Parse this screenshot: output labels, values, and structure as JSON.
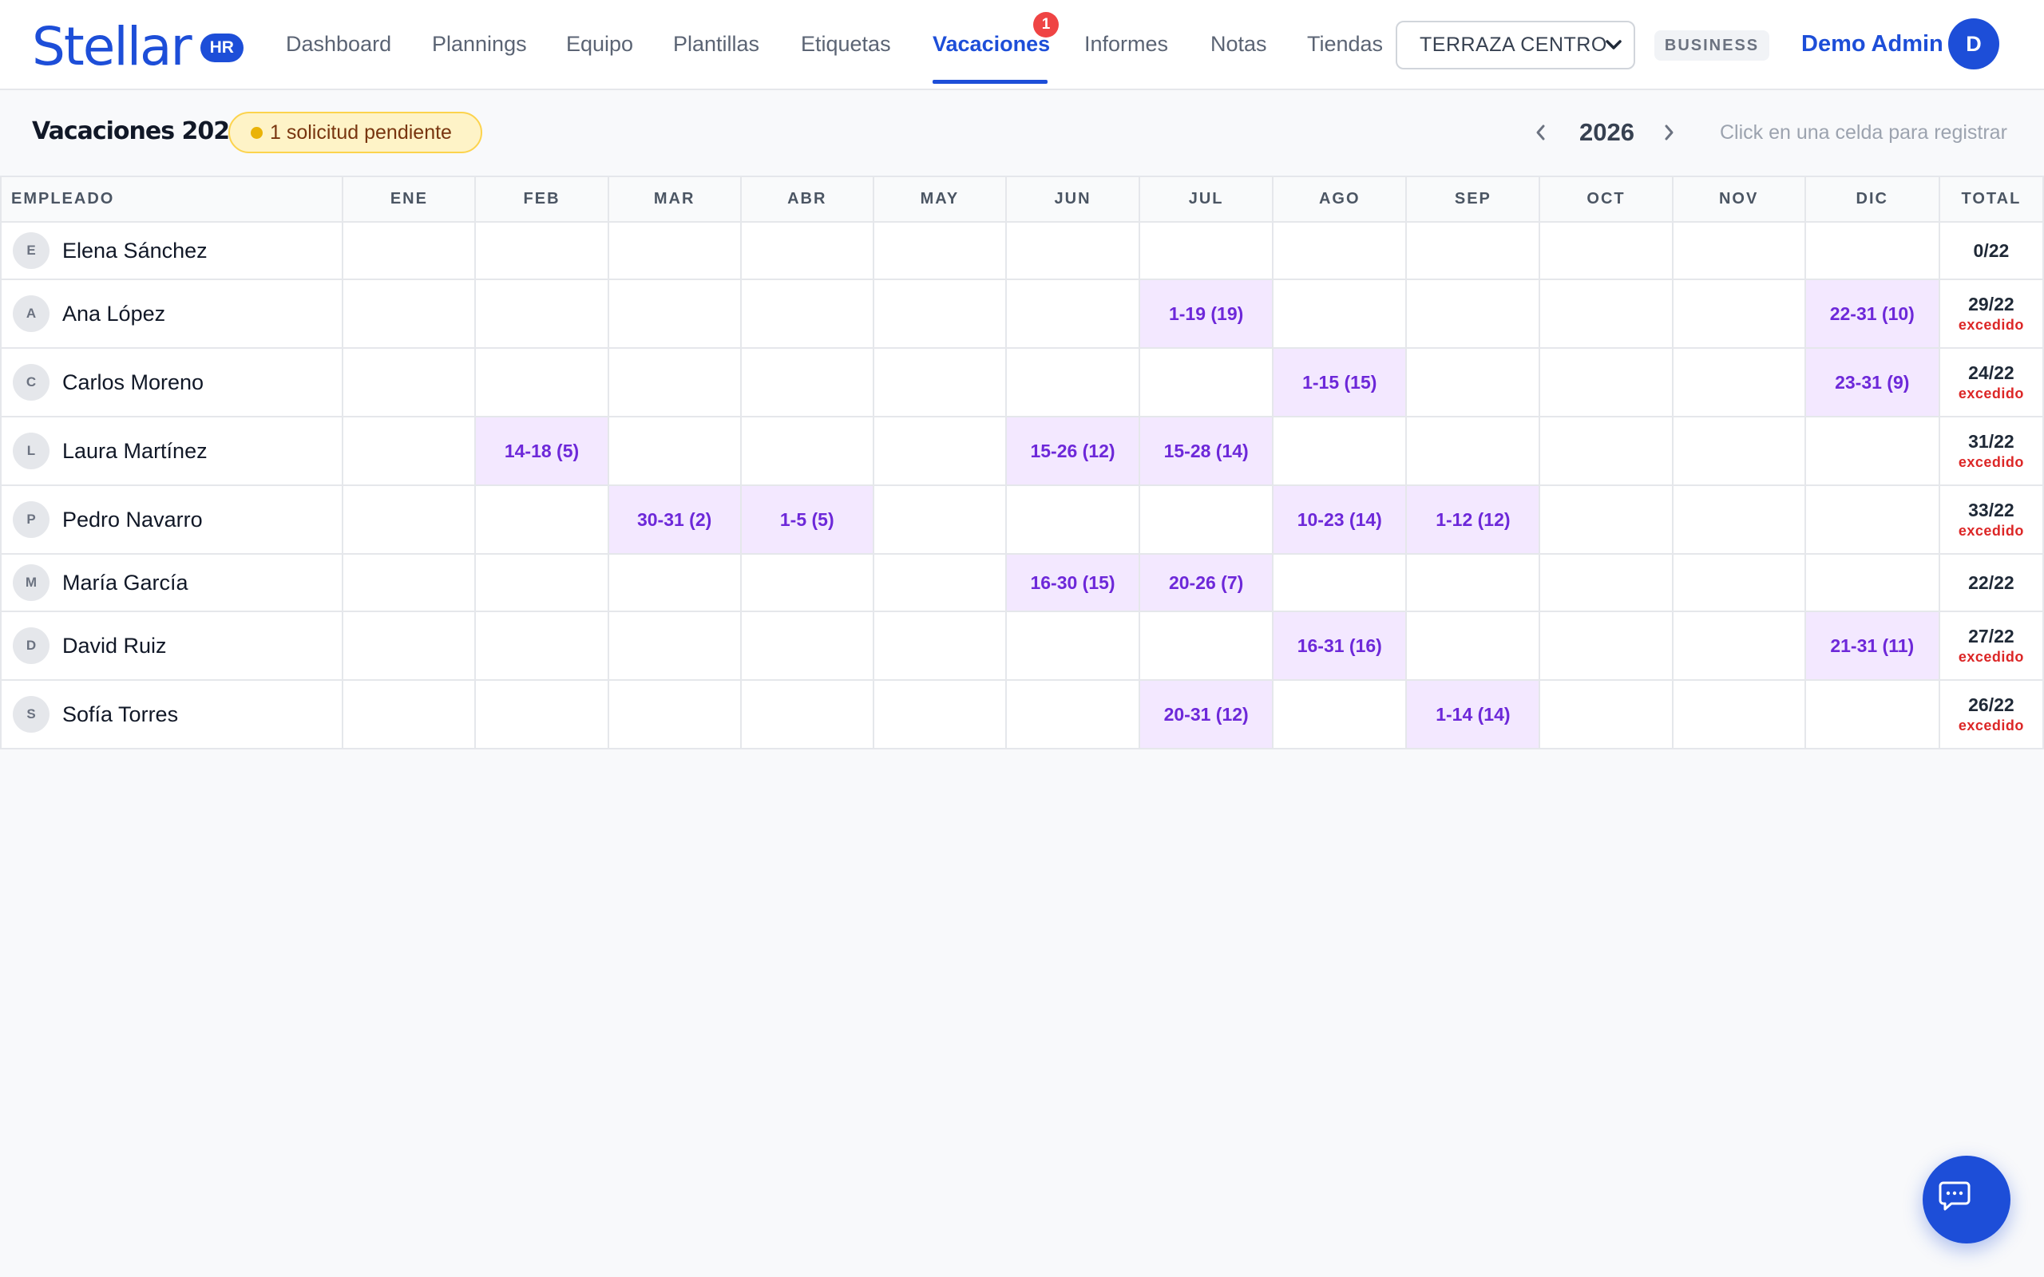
{
  "brand": {
    "name": "Stellar",
    "badge": "HR"
  },
  "nav": {
    "items": [
      "Dashboard",
      "Plannings",
      "Equipo",
      "Plantillas",
      "Etiquetas",
      "Vacaciones",
      "Informes",
      "Notas",
      "Tiendas"
    ],
    "active": "Vacaciones",
    "vacaciones_badge": "1"
  },
  "store_select": {
    "value": "TERRAZA CENTRO"
  },
  "plan_badge": "BUSINESS",
  "user": {
    "name": "Demo Admin",
    "initial": "D"
  },
  "page": {
    "title": "Vacaciones 2026",
    "pending": "1 solicitud pendiente",
    "year": "2026",
    "hint": "Click en una celda para registrar"
  },
  "table": {
    "headers": [
      "EMPLEADO",
      "ENE",
      "FEB",
      "MAR",
      "ABR",
      "MAY",
      "JUN",
      "JUL",
      "AGO",
      "SEP",
      "OCT",
      "NOV",
      "DIC",
      "TOTAL"
    ],
    "rows": [
      {
        "initial": "E",
        "name": "Elena Sánchez",
        "months": [
          "",
          "",
          "",
          "",
          "",
          "",
          "",
          "",
          "",
          "",
          "",
          ""
        ],
        "total": "0/22",
        "flag": ""
      },
      {
        "initial": "A",
        "name": "Ana López",
        "months": [
          "",
          "",
          "",
          "",
          "",
          "",
          "1-19 (19)",
          "",
          "",
          "",
          "",
          "22-31 (10)"
        ],
        "total": "29/22",
        "flag": "excedido"
      },
      {
        "initial": "C",
        "name": "Carlos Moreno",
        "months": [
          "",
          "",
          "",
          "",
          "",
          "",
          "",
          "1-15 (15)",
          "",
          "",
          "",
          "23-31 (9)"
        ],
        "total": "24/22",
        "flag": "excedido"
      },
      {
        "initial": "L",
        "name": "Laura Martínez",
        "months": [
          "",
          "14-18 (5)",
          "",
          "",
          "",
          "15-26 (12)",
          "15-28 (14)",
          "",
          "",
          "",
          "",
          ""
        ],
        "total": "31/22",
        "flag": "excedido"
      },
      {
        "initial": "P",
        "name": "Pedro Navarro",
        "months": [
          "",
          "",
          "30-31 (2)",
          "1-5 (5)",
          "",
          "",
          "",
          "10-23 (14)",
          "1-12 (12)",
          "",
          "",
          ""
        ],
        "total": "33/22",
        "flag": "excedido"
      },
      {
        "initial": "M",
        "name": "María García",
        "months": [
          "",
          "",
          "",
          "",
          "",
          "16-30 (15)",
          "20-26 (7)",
          "",
          "",
          "",
          "",
          ""
        ],
        "total": "22/22",
        "flag": ""
      },
      {
        "initial": "D",
        "name": "David Ruiz",
        "months": [
          "",
          "",
          "",
          "",
          "",
          "",
          "",
          "16-31 (16)",
          "",
          "",
          "",
          "21-31 (11)"
        ],
        "total": "27/22",
        "flag": "excedido"
      },
      {
        "initial": "S",
        "name": "Sofía Torres",
        "months": [
          "",
          "",
          "",
          "",
          "",
          "",
          "20-31 (12)",
          "",
          "1-14 (14)",
          "",
          "",
          ""
        ],
        "total": "26/22",
        "flag": "excedido"
      }
    ]
  },
  "icons": {
    "store_select": "chevron-down-icon",
    "year_prev": "chevron-left-icon",
    "year_next": "chevron-right-icon",
    "chat": "chat-icon"
  },
  "colors": {
    "brand": "#1d4ed8",
    "vacation_bg": "#f3e8ff",
    "vacation_text": "#6d28d9",
    "exceeded": "#dc2626",
    "pending_bg": "#fef3c7",
    "badge_red": "#ef4444"
  }
}
